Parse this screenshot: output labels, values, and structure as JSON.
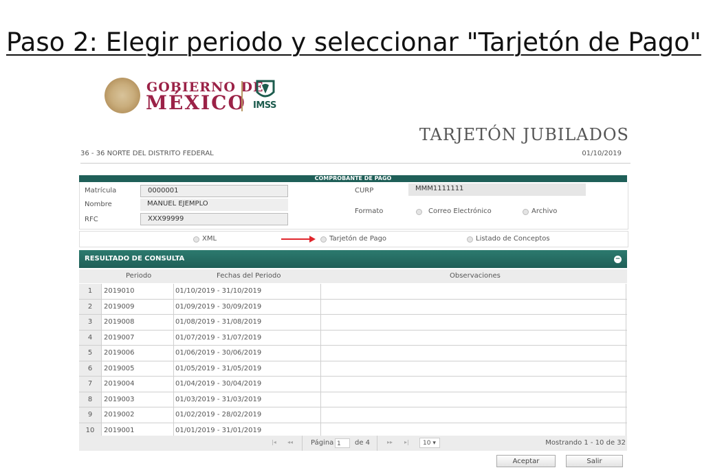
{
  "page_title": "Paso 2: Elegir periodo y seleccionar \"Tarjetón de Pago\"",
  "brand": {
    "gobierno_line1": "GOBIERNO DE",
    "gobierno_line2": "MÉXICO",
    "imss": "IMSS",
    "primary_color": "#9b2247",
    "imss_color": "#1d5c4e"
  },
  "header": {
    "title": "TARJETÓN JUBILADOS",
    "delegacion": "36 - 36 NORTE DEL DISTRITO FEDERAL",
    "fecha": "01/10/2019"
  },
  "comprobante": {
    "heading": "COMPROBANTE DE PAGO",
    "matricula_label": "Matrícula",
    "matricula_value": "0000001",
    "nombre_label": "Nombre",
    "nombre_value": "MANUEL EJEMPLO",
    "rfc_label": "RFC",
    "rfc_value": "XXX99999",
    "curp_label": "CURP",
    "curp_value": "MMM1111111",
    "formato_label": "Formato",
    "correo_label": "Correo Electrónico",
    "archivo_label": "Archivo"
  },
  "options": {
    "xml": "XML",
    "tarjeton": "Tarjetón de Pago",
    "listado": "Listado de Conceptos"
  },
  "arrow_color": "#e0262c",
  "resultado": {
    "heading": "RESULTADO DE CONSULTA",
    "columns": [
      "Periodo",
      "Fechas del Periodo",
      "Observaciones"
    ],
    "rows": [
      {
        "n": "1",
        "periodo": "2019010",
        "fechas": "01/10/2019 - 31/10/2019"
      },
      {
        "n": "2",
        "periodo": "2019009",
        "fechas": "01/09/2019 - 30/09/2019"
      },
      {
        "n": "3",
        "periodo": "2019008",
        "fechas": "01/08/2019 - 31/08/2019"
      },
      {
        "n": "4",
        "periodo": "2019007",
        "fechas": "01/07/2019 - 31/07/2019"
      },
      {
        "n": "5",
        "periodo": "2019006",
        "fechas": "01/06/2019 - 30/06/2019"
      },
      {
        "n": "6",
        "periodo": "2019005",
        "fechas": "01/05/2019 - 31/05/2019"
      },
      {
        "n": "7",
        "periodo": "2019004",
        "fechas": "01/04/2019 - 30/04/2019"
      },
      {
        "n": "8",
        "periodo": "2019003",
        "fechas": "01/03/2019 - 31/03/2019"
      },
      {
        "n": "9",
        "periodo": "2019002",
        "fechas": "01/02/2019 - 28/02/2019"
      },
      {
        "n": "10",
        "periodo": "2019001",
        "fechas": "01/01/2019 - 31/01/2019"
      }
    ]
  },
  "pager": {
    "first": "|◂",
    "prev": "◂◂",
    "pagina_label": "Página",
    "page": "1",
    "of_label": "de 4",
    "next": "▸▸",
    "last": "▸|",
    "page_size": "10 ▾",
    "mostrando": "Mostrando 1 - 10 de 32"
  },
  "buttons": {
    "aceptar": "Aceptar",
    "salir": "Salir"
  },
  "header_color": "#1f5f58"
}
